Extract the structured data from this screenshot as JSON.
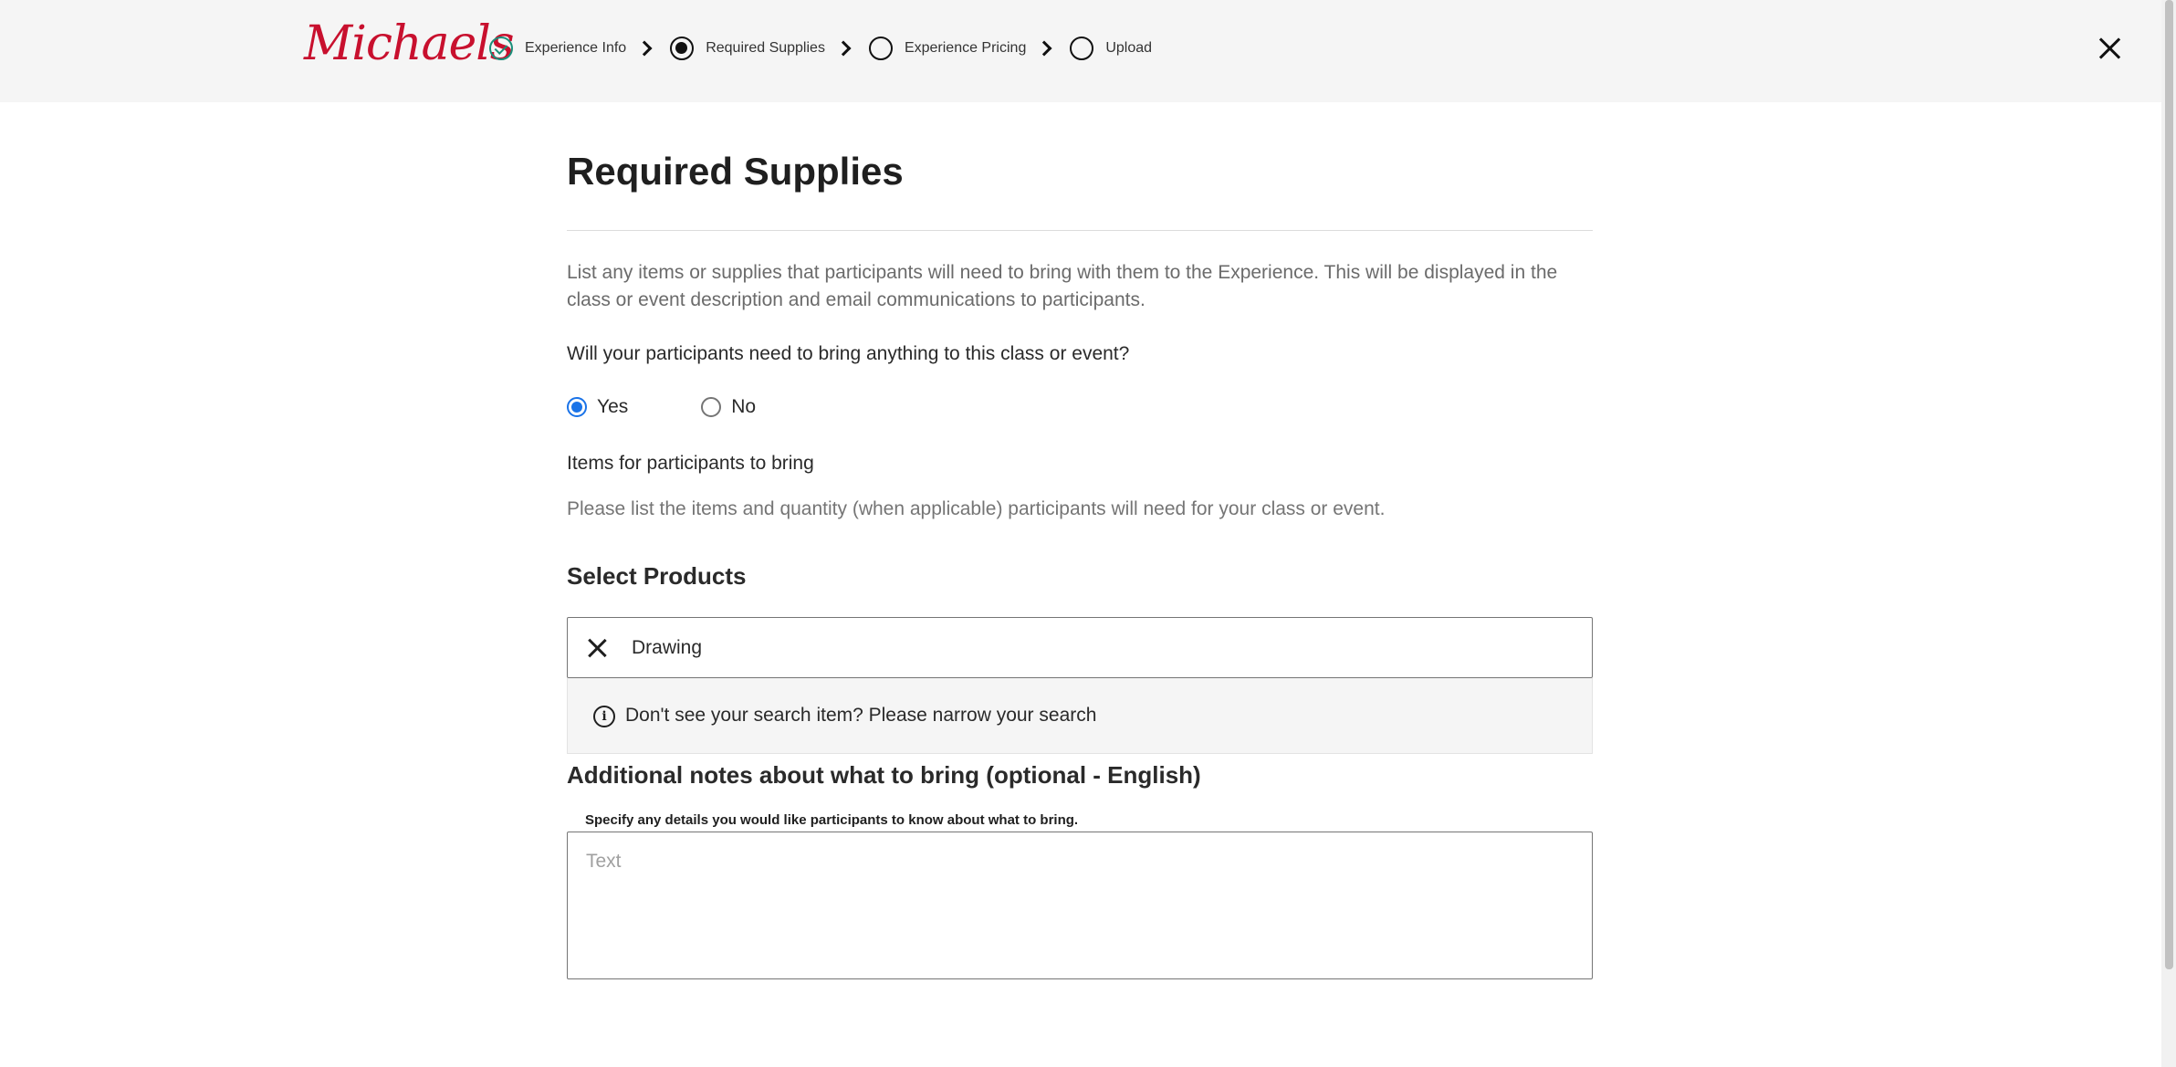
{
  "header": {
    "logo_text": "Michaels",
    "steps": [
      {
        "label": "Experience Info",
        "state": "done"
      },
      {
        "label": "Required Supplies",
        "state": "current"
      },
      {
        "label": "Experience Pricing",
        "state": "todo"
      },
      {
        "label": "Upload",
        "state": "todo"
      }
    ],
    "close_icon": "close-icon"
  },
  "page": {
    "title": "Required Supplies",
    "description": "List any items or supplies that participants will need to bring with them to the Experience. This will be displayed in the class or event description and email communications to participants.",
    "question": "Will your participants need to bring anything to this class or event?",
    "radio_options": [
      {
        "label": "Yes",
        "checked": true
      },
      {
        "label": "No",
        "checked": false
      }
    ],
    "items_label": "Items for participants to bring",
    "items_help": "Please list the items and quantity (when applicable) participants will need for your class or event.",
    "select_products_title": "Select Products",
    "search": {
      "value": "Drawing",
      "dropdown_message": "Don't see your search item? Please narrow your search"
    },
    "notes": {
      "title": "Additional notes about what to bring (optional - English)",
      "help": "Specify any details you would like participants to know about what to bring.",
      "placeholder": "Text"
    }
  },
  "colors": {
    "brand": "#c8102e",
    "done_step": "#1a8f7a",
    "radio_checked": "#1a73e8"
  }
}
